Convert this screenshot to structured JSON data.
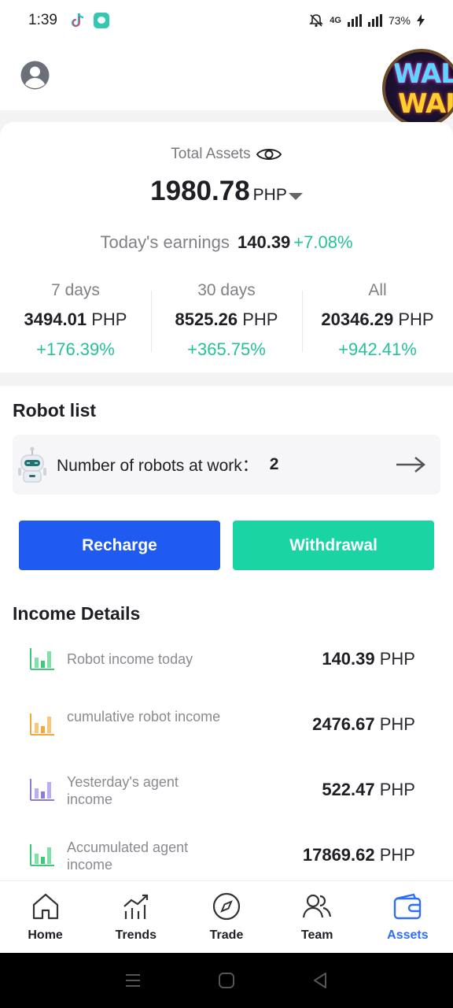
{
  "status_bar": {
    "time": "1:39",
    "network": "4G",
    "battery": "73%"
  },
  "header": {
    "sticker_text": "WAL WAL"
  },
  "assets": {
    "total_label": "Total Assets",
    "total_value": "1980.78",
    "currency": "PHP",
    "earnings_label": "Today's earnings",
    "earnings_value": "140.39",
    "earnings_pct": "+7.08%",
    "periods": [
      {
        "label": "7 days",
        "value": "3494.01",
        "currency": "PHP",
        "pct": "+176.39%"
      },
      {
        "label": "30 days",
        "value": "8525.26",
        "currency": "PHP",
        "pct": "+365.75%"
      },
      {
        "label": "All",
        "value": "20346.29",
        "currency": "PHP",
        "pct": "+942.41%"
      }
    ]
  },
  "robots": {
    "title": "Robot list",
    "working_label": "Number of robots at work：",
    "working_count": "2"
  },
  "actions": {
    "recharge": "Recharge",
    "withdrawal": "Withdrawal"
  },
  "income": {
    "title": "Income Details",
    "items": [
      {
        "label": "Robot income today",
        "value": "140.39",
        "currency": "PHP",
        "icon_color": "#3cc97a"
      },
      {
        "label": "cumulative robot income",
        "value": "2476.67",
        "currency": "PHP",
        "icon_color": "#f2a93b"
      },
      {
        "label": "Yesterday's agent income",
        "value": "522.47",
        "currency": "PHP",
        "icon_color": "#8b7be0"
      },
      {
        "label": "Accumulated agent income",
        "value": "17869.62",
        "currency": "PHP",
        "icon_color": "#3cc97a"
      }
    ]
  },
  "nav": {
    "items": [
      {
        "label": "Home",
        "icon": "home-icon"
      },
      {
        "label": "Trends",
        "icon": "trends-icon"
      },
      {
        "label": "Trade",
        "icon": "compass-icon"
      },
      {
        "label": "Team",
        "icon": "team-icon"
      },
      {
        "label": "Assets",
        "icon": "wallet-icon"
      }
    ],
    "active": "Assets",
    "active_color": "#2f6ef6"
  },
  "colors": {
    "positive": "#26c19a",
    "recharge": "#1f5bf0",
    "withdrawal": "#1ad5a3"
  }
}
